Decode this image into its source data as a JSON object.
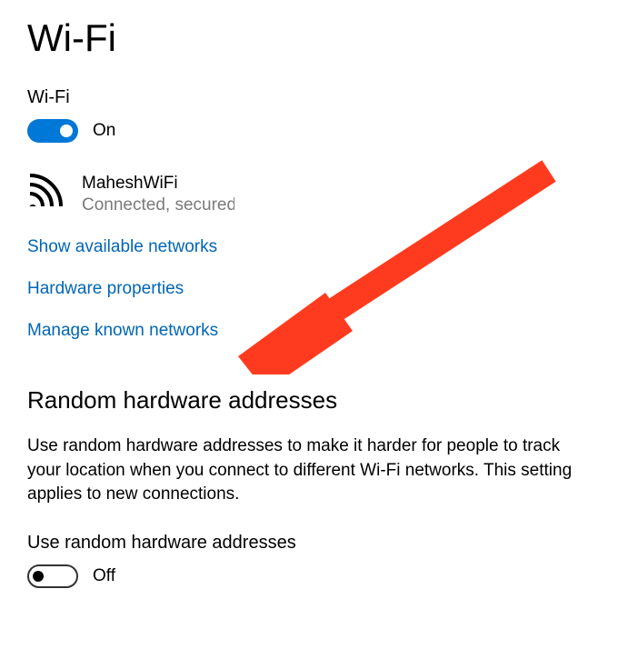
{
  "page_title": "Wi-Fi",
  "wifi": {
    "label": "Wi-Fi",
    "toggle_on": true,
    "toggle_text": "On",
    "network": {
      "name": "MaheshWiFi",
      "status": "Connected, secured"
    }
  },
  "links": {
    "show_available": "Show available networks",
    "hardware_props": "Hardware properties",
    "manage_known": "Manage known networks"
  },
  "random_hw": {
    "heading": "Random hardware addresses",
    "description": "Use random hardware addresses to make it harder for people to track your location when you connect to different Wi-Fi networks. This setting applies to new connections.",
    "toggle_label": "Use random hardware addresses",
    "toggle_on": false,
    "toggle_text": "Off"
  },
  "colors": {
    "accent": "#0078d7",
    "link": "#0066b4",
    "muted": "#7a7a7a",
    "arrow": "#ff3b1f"
  }
}
